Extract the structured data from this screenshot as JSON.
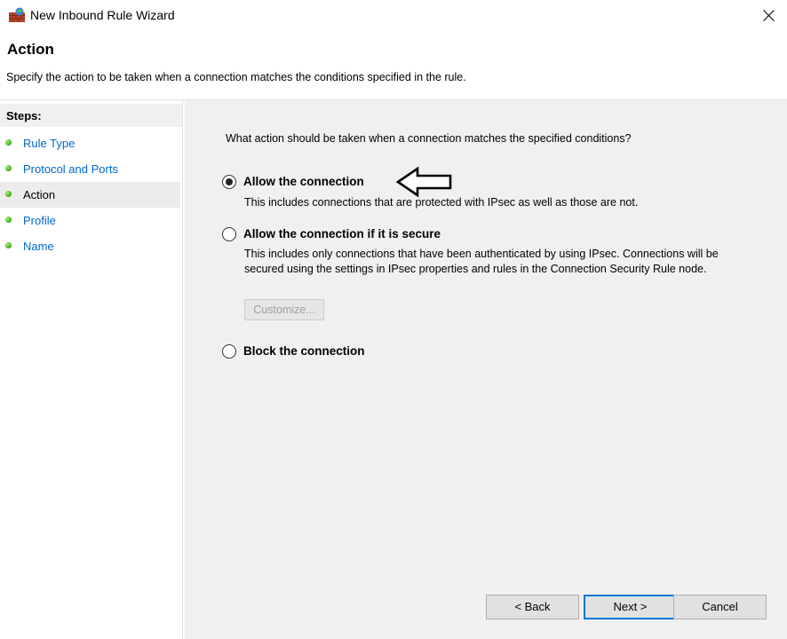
{
  "window": {
    "title": "New Inbound Rule Wizard",
    "app_icon": "firewall-brick-icon",
    "close_icon": "close-icon"
  },
  "page": {
    "title": "Action",
    "description": "Specify the action to be taken when a connection matches the conditions specified in the rule."
  },
  "sidebar": {
    "header": "Steps:",
    "items": [
      {
        "label": "Rule Type",
        "active": false
      },
      {
        "label": "Protocol and Ports",
        "active": false
      },
      {
        "label": "Action",
        "active": true
      },
      {
        "label": "Profile",
        "active": false
      },
      {
        "label": "Name",
        "active": false
      }
    ]
  },
  "main": {
    "question": "What action should be taken when a connection matches the specified conditions?",
    "options": [
      {
        "label": "Allow the connection",
        "description": "This includes connections that are protected with IPsec as well as those are not.",
        "selected": true
      },
      {
        "label": "Allow the connection if it is secure",
        "description": "This includes only connections that have been authenticated by using IPsec.  Connections will be secured using the settings in IPsec properties and rules in the Connection Security Rule node.",
        "selected": false
      },
      {
        "label": "Block the connection",
        "description": "",
        "selected": false
      }
    ],
    "customize_label": "Customize..."
  },
  "footer": {
    "back_label": "< Back",
    "next_label": "Next >",
    "cancel_label": "Cancel"
  },
  "colors": {
    "link": "#0066cc",
    "panel_bg": "#f0f0f0",
    "default_button_border": "#0078d7"
  }
}
